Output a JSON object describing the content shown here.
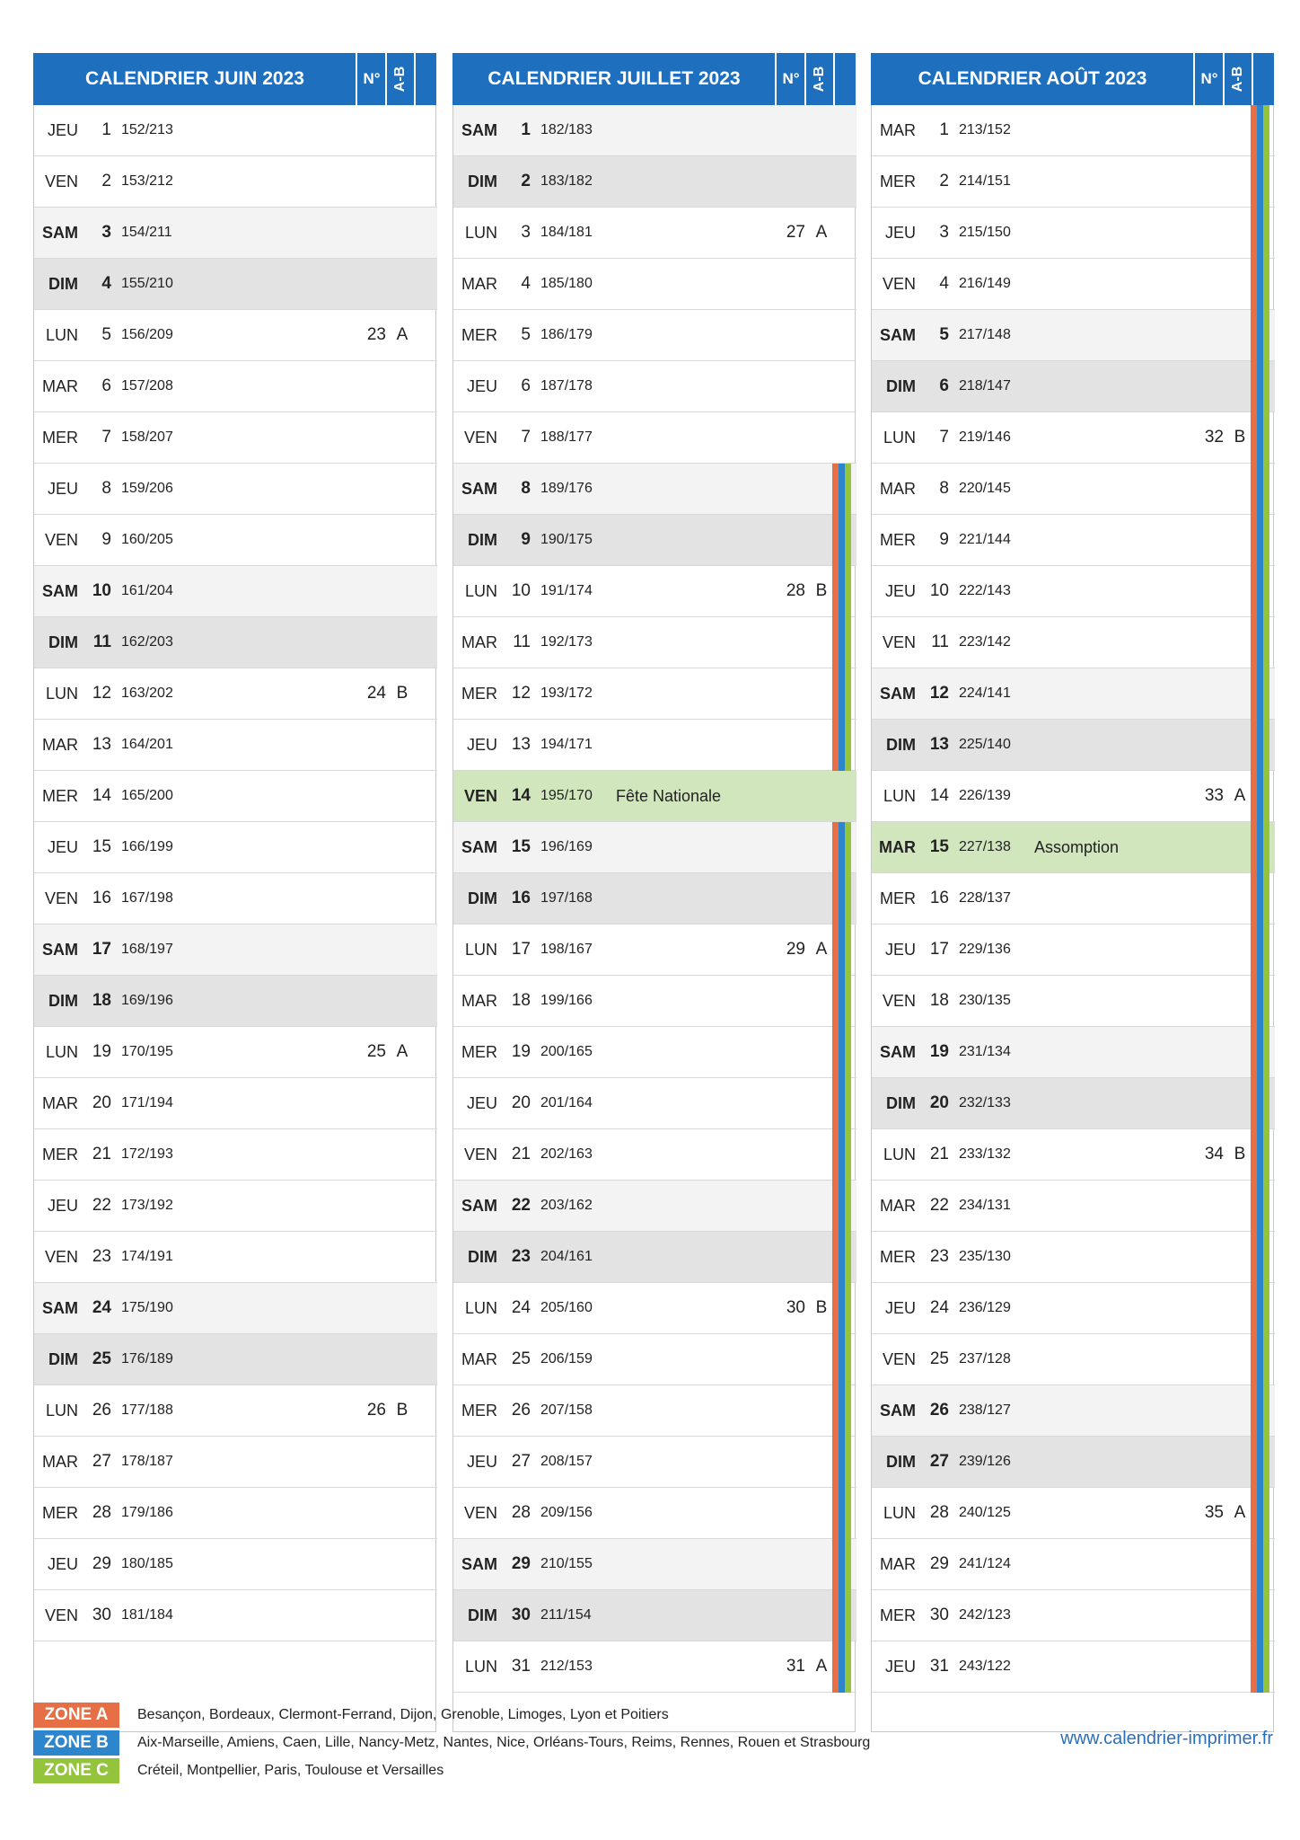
{
  "months": [
    {
      "title": "CALENDRIER JUIN 2023",
      "num_header": "N°",
      "ab_header": "A-B",
      "days": [
        {
          "dow": "JEU",
          "day": "1",
          "doy": "152/213"
        },
        {
          "dow": "VEN",
          "day": "2",
          "doy": "153/212"
        },
        {
          "dow": "SAM",
          "day": "3",
          "doy": "154/211"
        },
        {
          "dow": "DIM",
          "day": "4",
          "doy": "155/210"
        },
        {
          "dow": "LUN",
          "day": "5",
          "doy": "156/209",
          "week": "23",
          "ab": "A"
        },
        {
          "dow": "MAR",
          "day": "6",
          "doy": "157/208"
        },
        {
          "dow": "MER",
          "day": "7",
          "doy": "158/207"
        },
        {
          "dow": "JEU",
          "day": "8",
          "doy": "159/206"
        },
        {
          "dow": "VEN",
          "day": "9",
          "doy": "160/205"
        },
        {
          "dow": "SAM",
          "day": "10",
          "doy": "161/204"
        },
        {
          "dow": "DIM",
          "day": "11",
          "doy": "162/203"
        },
        {
          "dow": "LUN",
          "day": "12",
          "doy": "163/202",
          "week": "24",
          "ab": "B"
        },
        {
          "dow": "MAR",
          "day": "13",
          "doy": "164/201"
        },
        {
          "dow": "MER",
          "day": "14",
          "doy": "165/200"
        },
        {
          "dow": "JEU",
          "day": "15",
          "doy": "166/199"
        },
        {
          "dow": "VEN",
          "day": "16",
          "doy": "167/198"
        },
        {
          "dow": "SAM",
          "day": "17",
          "doy": "168/197"
        },
        {
          "dow": "DIM",
          "day": "18",
          "doy": "169/196"
        },
        {
          "dow": "LUN",
          "day": "19",
          "doy": "170/195",
          "week": "25",
          "ab": "A"
        },
        {
          "dow": "MAR",
          "day": "20",
          "doy": "171/194"
        },
        {
          "dow": "MER",
          "day": "21",
          "doy": "172/193"
        },
        {
          "dow": "JEU",
          "day": "22",
          "doy": "173/192"
        },
        {
          "dow": "VEN",
          "day": "23",
          "doy": "174/191"
        },
        {
          "dow": "SAM",
          "day": "24",
          "doy": "175/190"
        },
        {
          "dow": "DIM",
          "day": "25",
          "doy": "176/189"
        },
        {
          "dow": "LUN",
          "day": "26",
          "doy": "177/188",
          "week": "26",
          "ab": "B"
        },
        {
          "dow": "MAR",
          "day": "27",
          "doy": "178/187"
        },
        {
          "dow": "MER",
          "day": "28",
          "doy": "179/186"
        },
        {
          "dow": "JEU",
          "day": "29",
          "doy": "180/185"
        },
        {
          "dow": "VEN",
          "day": "30",
          "doy": "181/184"
        }
      ]
    },
    {
      "title": "CALENDRIER JUILLET 2023",
      "num_header": "N°",
      "ab_header": "A-B",
      "days": [
        {
          "dow": "SAM",
          "day": "1",
          "doy": "182/183"
        },
        {
          "dow": "DIM",
          "day": "2",
          "doy": "183/182"
        },
        {
          "dow": "LUN",
          "day": "3",
          "doy": "184/181",
          "week": "27",
          "ab": "A"
        },
        {
          "dow": "MAR",
          "day": "4",
          "doy": "185/180"
        },
        {
          "dow": "MER",
          "day": "5",
          "doy": "186/179"
        },
        {
          "dow": "JEU",
          "day": "6",
          "doy": "187/178"
        },
        {
          "dow": "VEN",
          "day": "7",
          "doy": "188/177"
        },
        {
          "dow": "SAM",
          "day": "8",
          "doy": "189/176",
          "zones": true
        },
        {
          "dow": "DIM",
          "day": "9",
          "doy": "190/175",
          "zones": true
        },
        {
          "dow": "LUN",
          "day": "10",
          "doy": "191/174",
          "week": "28",
          "ab": "B",
          "zones": true
        },
        {
          "dow": "MAR",
          "day": "11",
          "doy": "192/173",
          "zones": true
        },
        {
          "dow": "MER",
          "day": "12",
          "doy": "193/172",
          "zones": true
        },
        {
          "dow": "JEU",
          "day": "13",
          "doy": "194/171",
          "zones": true
        },
        {
          "dow": "VEN",
          "day": "14",
          "doy": "195/170",
          "holiday": "Fête Nationale"
        },
        {
          "dow": "SAM",
          "day": "15",
          "doy": "196/169",
          "zones": true
        },
        {
          "dow": "DIM",
          "day": "16",
          "doy": "197/168",
          "zones": true
        },
        {
          "dow": "LUN",
          "day": "17",
          "doy": "198/167",
          "week": "29",
          "ab": "A",
          "zones": true
        },
        {
          "dow": "MAR",
          "day": "18",
          "doy": "199/166",
          "zones": true
        },
        {
          "dow": "MER",
          "day": "19",
          "doy": "200/165",
          "zones": true
        },
        {
          "dow": "JEU",
          "day": "20",
          "doy": "201/164",
          "zones": true
        },
        {
          "dow": "VEN",
          "day": "21",
          "doy": "202/163",
          "zones": true
        },
        {
          "dow": "SAM",
          "day": "22",
          "doy": "203/162",
          "zones": true
        },
        {
          "dow": "DIM",
          "day": "23",
          "doy": "204/161",
          "zones": true
        },
        {
          "dow": "LUN",
          "day": "24",
          "doy": "205/160",
          "week": "30",
          "ab": "B",
          "zones": true
        },
        {
          "dow": "MAR",
          "day": "25",
          "doy": "206/159",
          "zones": true
        },
        {
          "dow": "MER",
          "day": "26",
          "doy": "207/158",
          "zones": true
        },
        {
          "dow": "JEU",
          "day": "27",
          "doy": "208/157",
          "zones": true
        },
        {
          "dow": "VEN",
          "day": "28",
          "doy": "209/156",
          "zones": true
        },
        {
          "dow": "SAM",
          "day": "29",
          "doy": "210/155",
          "zones": true
        },
        {
          "dow": "DIM",
          "day": "30",
          "doy": "211/154",
          "zones": true
        },
        {
          "dow": "LUN",
          "day": "31",
          "doy": "212/153",
          "week": "31",
          "ab": "A",
          "zones": true
        }
      ]
    },
    {
      "title": "CALENDRIER AOÛT 2023",
      "num_header": "N°",
      "ab_header": "A-B",
      "days": [
        {
          "dow": "MAR",
          "day": "1",
          "doy": "213/152",
          "zones": true
        },
        {
          "dow": "MER",
          "day": "2",
          "doy": "214/151",
          "zones": true
        },
        {
          "dow": "JEU",
          "day": "3",
          "doy": "215/150",
          "zones": true
        },
        {
          "dow": "VEN",
          "day": "4",
          "doy": "216/149",
          "zones": true
        },
        {
          "dow": "SAM",
          "day": "5",
          "doy": "217/148",
          "zones": true
        },
        {
          "dow": "DIM",
          "day": "6",
          "doy": "218/147",
          "zones": true
        },
        {
          "dow": "LUN",
          "day": "7",
          "doy": "219/146",
          "week": "32",
          "ab": "B",
          "zones": true
        },
        {
          "dow": "MAR",
          "day": "8",
          "doy": "220/145",
          "zones": true
        },
        {
          "dow": "MER",
          "day": "9",
          "doy": "221/144",
          "zones": true
        },
        {
          "dow": "JEU",
          "day": "10",
          "doy": "222/143",
          "zones": true
        },
        {
          "dow": "VEN",
          "day": "11",
          "doy": "223/142",
          "zones": true
        },
        {
          "dow": "SAM",
          "day": "12",
          "doy": "224/141",
          "zones": true
        },
        {
          "dow": "DIM",
          "day": "13",
          "doy": "225/140",
          "zones": true
        },
        {
          "dow": "LUN",
          "day": "14",
          "doy": "226/139",
          "week": "33",
          "ab": "A",
          "zones": true
        },
        {
          "dow": "MAR",
          "day": "15",
          "doy": "227/138",
          "holiday": "Assomption",
          "zones": true
        },
        {
          "dow": "MER",
          "day": "16",
          "doy": "228/137",
          "zones": true
        },
        {
          "dow": "JEU",
          "day": "17",
          "doy": "229/136",
          "zones": true
        },
        {
          "dow": "VEN",
          "day": "18",
          "doy": "230/135",
          "zones": true
        },
        {
          "dow": "SAM",
          "day": "19",
          "doy": "231/134",
          "zones": true
        },
        {
          "dow": "DIM",
          "day": "20",
          "doy": "232/133",
          "zones": true
        },
        {
          "dow": "LUN",
          "day": "21",
          "doy": "233/132",
          "week": "34",
          "ab": "B",
          "zones": true
        },
        {
          "dow": "MAR",
          "day": "22",
          "doy": "234/131",
          "zones": true
        },
        {
          "dow": "MER",
          "day": "23",
          "doy": "235/130",
          "zones": true
        },
        {
          "dow": "JEU",
          "day": "24",
          "doy": "236/129",
          "zones": true
        },
        {
          "dow": "VEN",
          "day": "25",
          "doy": "237/128",
          "zones": true
        },
        {
          "dow": "SAM",
          "day": "26",
          "doy": "238/127",
          "zones": true
        },
        {
          "dow": "DIM",
          "day": "27",
          "doy": "239/126",
          "zones": true
        },
        {
          "dow": "LUN",
          "day": "28",
          "doy": "240/125",
          "week": "35",
          "ab": "A",
          "zones": true
        },
        {
          "dow": "MAR",
          "day": "29",
          "doy": "241/124",
          "zones": true
        },
        {
          "dow": "MER",
          "day": "30",
          "doy": "242/123",
          "zones": true
        },
        {
          "dow": "JEU",
          "day": "31",
          "doy": "243/122",
          "zones": true
        }
      ]
    }
  ],
  "legend": [
    {
      "label": "ZONE A",
      "color": "#e66f45",
      "text": "Besançon, Bordeaux, Clermont-Ferrand, Dijon, Grenoble, Limoges, Lyon et Poitiers"
    },
    {
      "label": "ZONE B",
      "color": "#2d85cc",
      "text": "Aix-Marseille, Amiens, Caen, Lille, Nancy-Metz, Nantes, Nice, Orléans-Tours, Reims, Rennes, Rouen et Strasbourg"
    },
    {
      "label": "ZONE C",
      "color": "#93c43b",
      "text": "Créteil, Montpellier, Paris, Toulouse et Versailles"
    }
  ],
  "website": "www.calendrier-imprimer.fr",
  "colors": {
    "header": "#1f6fbf",
    "holiday": "#d2e6be",
    "saturday": "#f3f3f3",
    "sunday": "#e3e3e3"
  }
}
